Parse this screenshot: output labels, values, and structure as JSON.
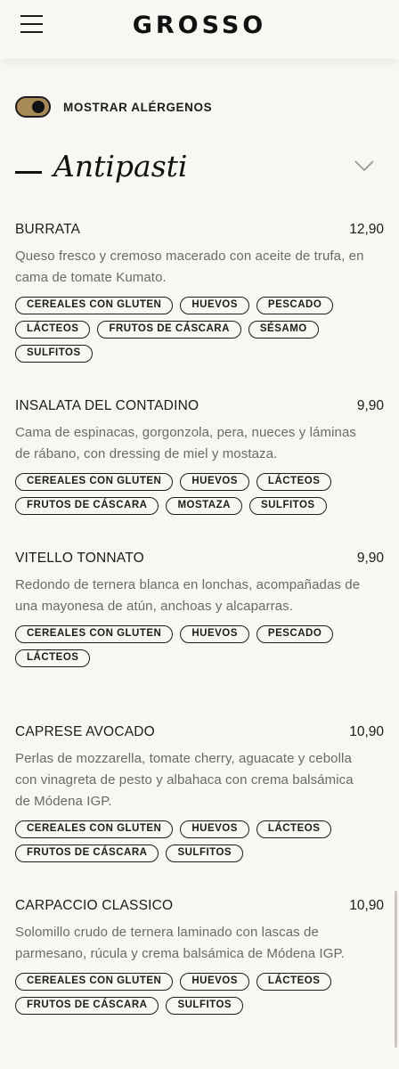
{
  "header": {
    "logo": "GROSSO",
    "menu_icon": "hamburger-menu-icon"
  },
  "toggle": {
    "label": "MOSTRAR ALÉRGENOS",
    "on": true
  },
  "section": {
    "title": "Antipasti",
    "chevron_icon": "chevron-down-icon"
  },
  "items": [
    {
      "name": "BURRATA",
      "price": "12,90",
      "description": "Queso fresco y cremoso macerado con aceite de trufa, en cama de tomate Kumato.",
      "allergens": [
        "CEREALES CON GLUTEN",
        "HUEVOS",
        "PESCADO",
        "LÁCTEOS",
        "FRUTOS DE CÁSCARA",
        "SÉSAMO",
        "SULFITOS"
      ]
    },
    {
      "name": "INSALATA DEL CONTADINO",
      "price": "9,90",
      "description": "Cama de espinacas, gorgonzola, pera, nueces y láminas de rábano, con dressing de miel y mostaza.",
      "allergens": [
        "CEREALES CON GLUTEN",
        "HUEVOS",
        "LÁCTEOS",
        "FRUTOS DE CÁSCARA",
        "MOSTAZA",
        "SULFITOS"
      ]
    },
    {
      "name": "VITELLO TONNATO",
      "price": "9,90",
      "description": "Redondo de ternera blanca en lonchas, acompañadas de una mayonesa de atún, anchoas y alcaparras.",
      "allergens": [
        "CEREALES CON GLUTEN",
        "HUEVOS",
        "PESCADO",
        "LÁCTEOS"
      ]
    },
    {
      "name": "CAPRESE AVOCADO",
      "price": "10,90",
      "description": "Perlas de mozzarella, tomate cherry, aguacate y cebolla con vinagreta de pesto y albahaca con crema balsámica de Módena IGP.",
      "allergens": [
        "CEREALES CON GLUTEN",
        "HUEVOS",
        "LÁCTEOS",
        "FRUTOS DE CÁSCARA",
        "SULFITOS"
      ]
    },
    {
      "name": "CARPACCIO CLASSICO",
      "price": "10,90",
      "description": "Solomillo crudo de ternera laminado con lascas de parmesano, rúcula y crema balsámica de Módena IGP.",
      "allergens": [
        "CEREALES CON GLUTEN",
        "HUEVOS",
        "LÁCTEOS",
        "FRUTOS DE CÁSCARA",
        "SULFITOS"
      ]
    }
  ]
}
